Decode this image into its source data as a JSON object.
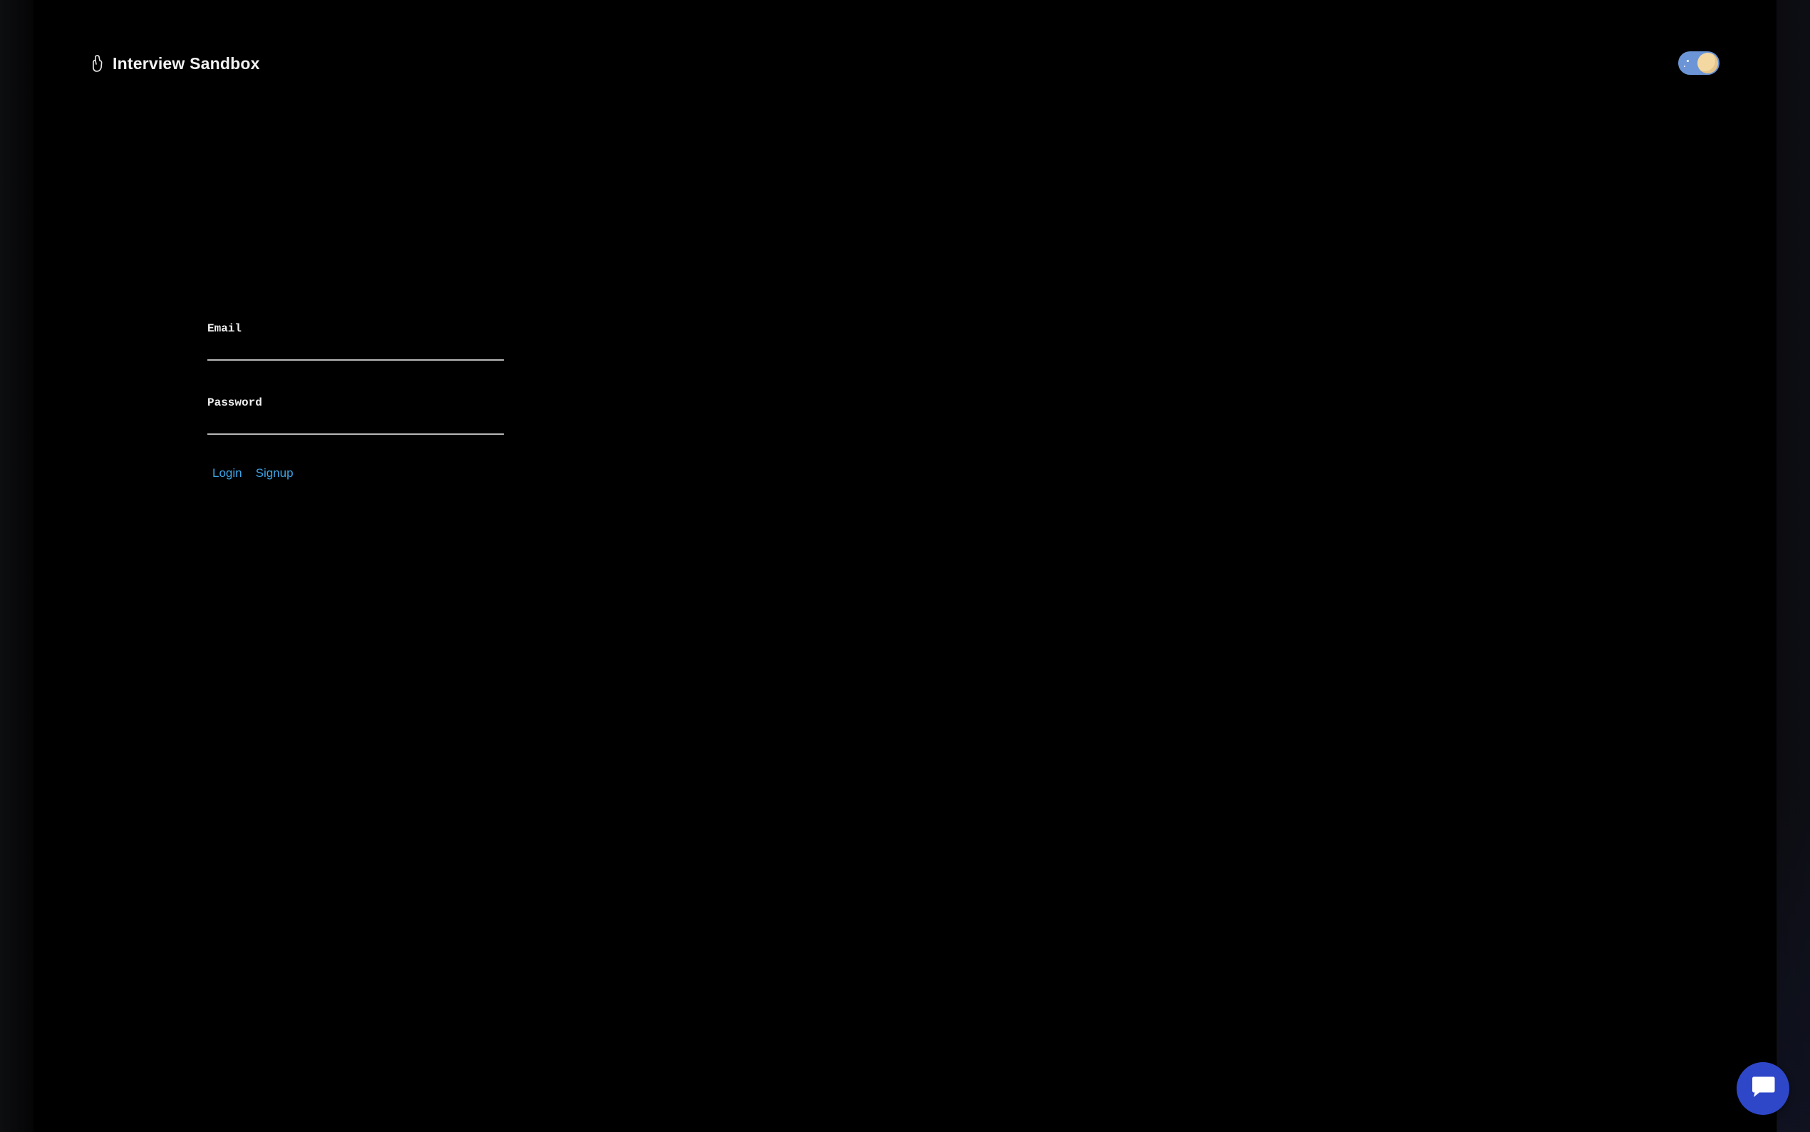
{
  "header": {
    "brand_icon": "hand-outline-icon",
    "title": "Interview Sandbox",
    "theme_toggle_icon": "moon-icon"
  },
  "login_form": {
    "email_label": "Email",
    "email_value": "",
    "password_label": "Password",
    "password_value": "",
    "login_label": "Login",
    "signup_label": "Signup"
  },
  "chat": {
    "icon": "chat-bubble-icon"
  },
  "colors": {
    "background": "#000000",
    "link": "#3da4e6",
    "toggle_track": "#6b95d6",
    "toggle_knob": "#f3d8a2",
    "chat_button": "#2e47c9"
  }
}
